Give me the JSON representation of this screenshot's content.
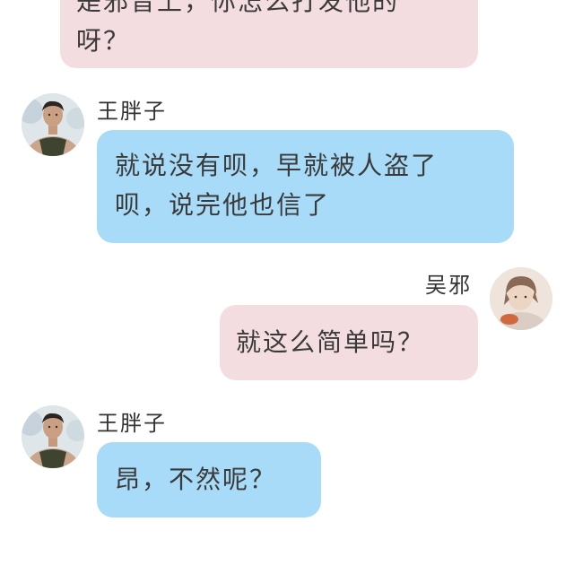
{
  "messages": [
    {
      "id": "m0",
      "side": "right",
      "color": "pink",
      "text_line1": "是邪音上，你怎么打发他的",
      "text_line2": "呀？"
    },
    {
      "id": "m1",
      "side": "left",
      "sender": "王胖子",
      "avatar_icon": "man-in-tank-top-avatar",
      "color": "blue",
      "text_line1": "就说没有呗，早就被人盗了",
      "text_line2": "呗，说完他也信了"
    },
    {
      "id": "m2",
      "side": "right",
      "sender": "吴邪",
      "avatar_icon": "illustrated-young-man-avatar",
      "color": "pink",
      "text_line1": "就这么简单吗？"
    },
    {
      "id": "m3",
      "side": "left",
      "sender": "王胖子",
      "avatar_icon": "man-in-tank-top-avatar",
      "color": "blue",
      "text_line1": "昂，不然呢？"
    }
  ],
  "colors": {
    "pink_bubble": "#f4dde0",
    "blue_bubble": "#a8dbf8",
    "text": "#3a3a3a"
  }
}
